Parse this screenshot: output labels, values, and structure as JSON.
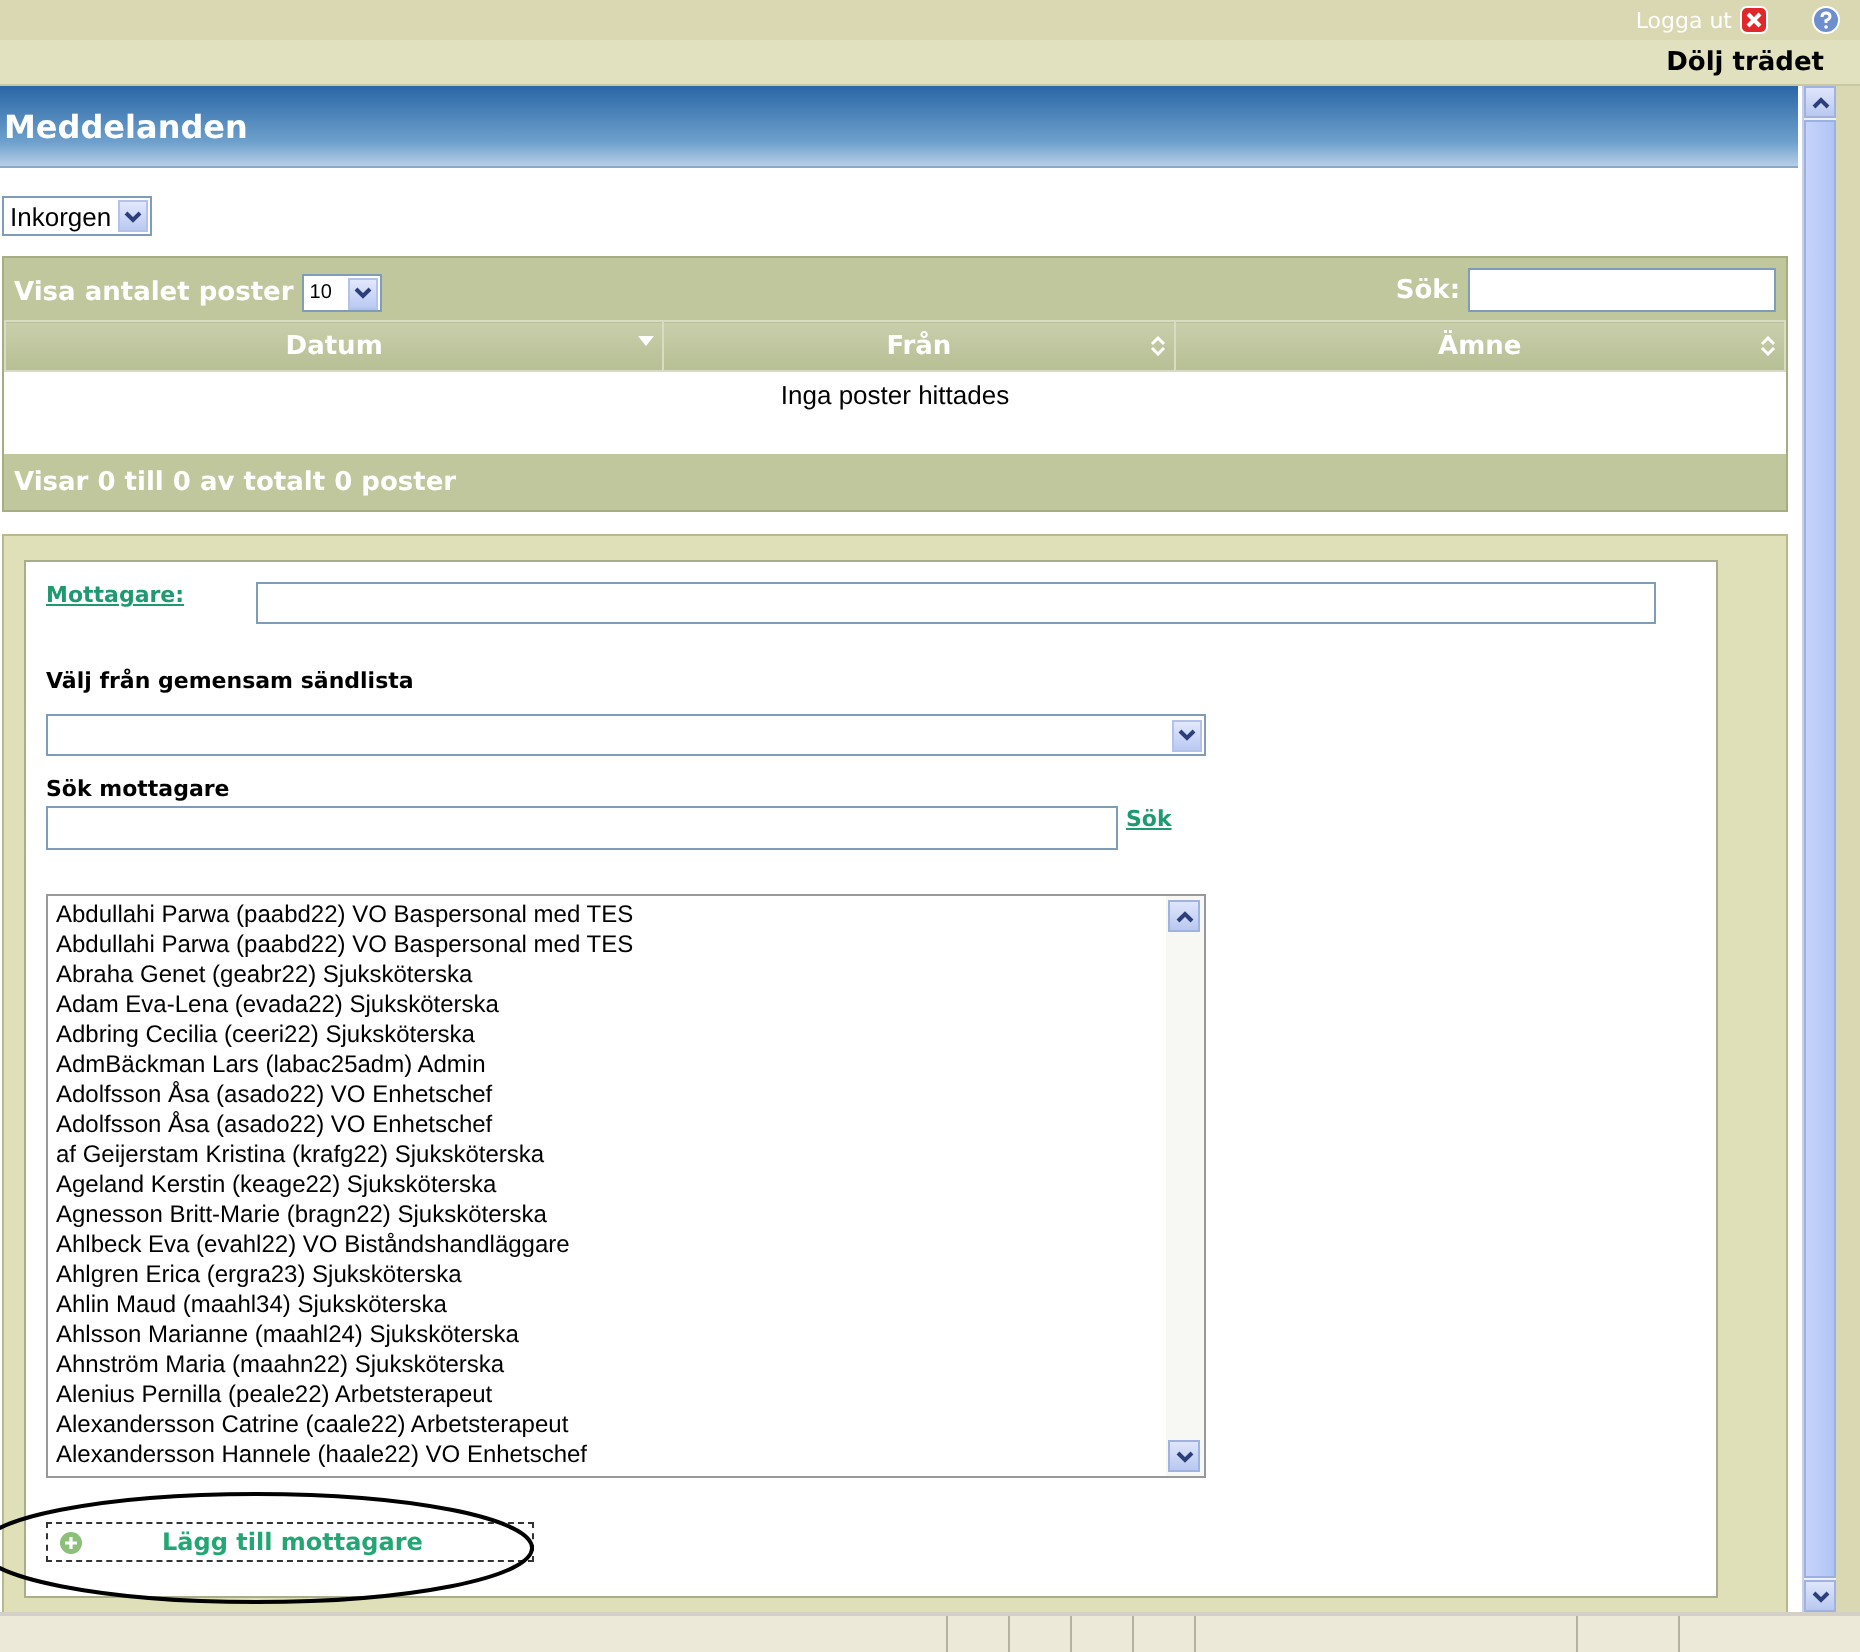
{
  "top_bar": {
    "logout": "Logga ut"
  },
  "tree_toggle": "Dölj trädet",
  "header": {
    "title": "Meddelanden"
  },
  "folder_select": {
    "value": "Inkorgen"
  },
  "table": {
    "length_label": "Visa antalet poster",
    "length_value": "10",
    "search_label": "Sök:",
    "columns": [
      {
        "label": "Datum",
        "sorted": true
      },
      {
        "label": "Från",
        "sorted": false
      },
      {
        "label": "Ämne",
        "sorted": false
      }
    ],
    "empty_message": "Inga poster hittades",
    "info": "Visar 0 till 0 av totalt 0 poster"
  },
  "form": {
    "recipient_label": "Mottagare:",
    "list_label": "Välj från gemensam sändlista",
    "search_label": "Sök mottagare",
    "search_link": "Sök",
    "recipients": [
      "Abdullahi Parwa (paabd22) VO Baspersonal med TES",
      "Abdullahi Parwa (paabd22) VO Baspersonal med TES",
      "Abraha Genet (geabr22) Sjuksköterska",
      "Adam Eva-Lena (evada22) Sjuksköterska",
      "Adbring Cecilia (ceeri22) Sjuksköterska",
      "AdmBäckman Lars (labac25adm) Admin",
      "Adolfsson Åsa (asado22) VO Enhetschef",
      "Adolfsson Åsa (asado22) VO Enhetschef",
      "af Geijerstam Kristina (krafg22) Sjuksköterska",
      "Ageland Kerstin (keage22) Sjuksköterska",
      "Agnesson Britt-Marie (bragn22) Sjuksköterska",
      "Ahlbeck Eva (evahl22) VO Biståndshandläggare",
      "Ahlgren Erica (ergra23) Sjuksköterska",
      "Ahlin Maud (maahl34) Sjuksköterska",
      "Ahlsson Marianne (maahl24) Sjuksköterska",
      "Ahnström Maria (maahn22) Sjuksköterska",
      "Alenius Pernilla (peale22) Arbetsterapeut",
      "Alexandersson Catrine (caale22) Arbetsterapeut",
      "Alexandersson Hannele (haale22) VO Enhetschef"
    ],
    "add_button": "Lägg till mottagare"
  }
}
